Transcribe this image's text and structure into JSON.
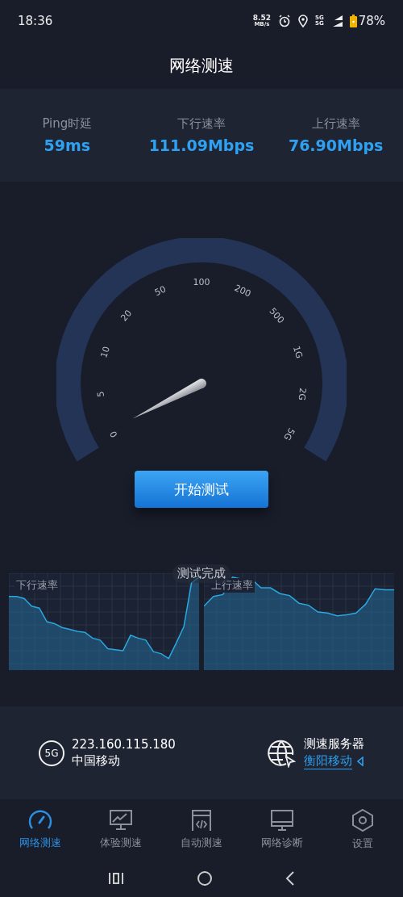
{
  "status_bar": {
    "time": "18:36",
    "net_speed": "8.52",
    "net_unit": "MB/s",
    "network_top": "5G",
    "network_bottom": "5G",
    "battery": "78%"
  },
  "title": "网络测速",
  "stats": [
    {
      "label": "Ping时延",
      "value": "59ms"
    },
    {
      "label": "下行速率",
      "value": "111.09Mbps"
    },
    {
      "label": "上行速率",
      "value": "76.90Mbps"
    }
  ],
  "gauge": {
    "ticks": [
      "0",
      "5",
      "10",
      "20",
      "50",
      "100",
      "200",
      "500",
      "1G",
      "2G",
      "5G"
    ]
  },
  "start_button": "开始测试",
  "graphs": [
    {
      "label": "下行速率"
    },
    {
      "label": "上行速率"
    }
  ],
  "toast": "测试完成",
  "network": {
    "badge": "5G",
    "ip": "223.160.115.180",
    "carrier": "中国移动"
  },
  "server": {
    "label": "测速服务器",
    "name": "衡阳移动"
  },
  "tabs": [
    {
      "label": "网络测速",
      "kind": "gauge",
      "selected": true
    },
    {
      "label": "体验测速",
      "kind": "monitor-chart",
      "selected": false
    },
    {
      "label": "自动测速",
      "kind": "code-window",
      "selected": false
    },
    {
      "label": "网络诊断",
      "kind": "monitor",
      "selected": false
    },
    {
      "label": "设置",
      "kind": "hexagon",
      "selected": false
    }
  ]
}
